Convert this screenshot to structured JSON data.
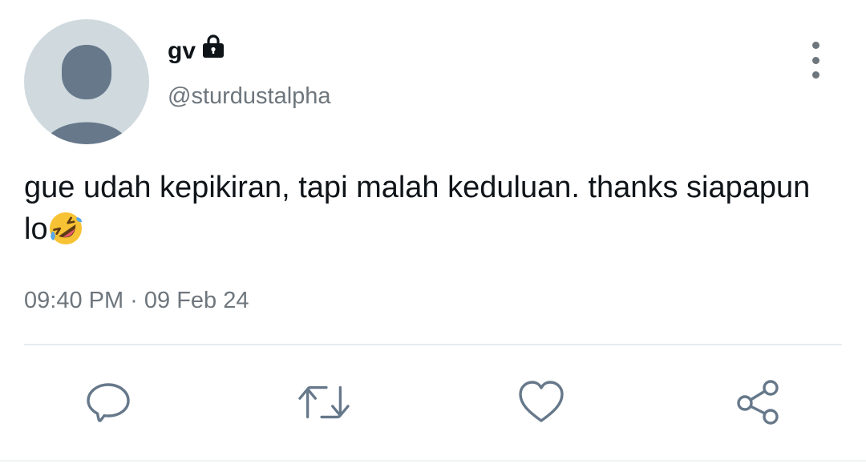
{
  "tweet": {
    "author": {
      "display_name": "gv",
      "handle": "@sturdustalpha",
      "protected_icon": "lock-icon",
      "avatar_icon": "default-avatar-icon"
    },
    "text": "gue udah kepikiran, tapi malah keduluan. thanks siapapun lo",
    "emoji": "rolling-on-floor-laughing-emoji",
    "timestamp": "09:40 PM · 09 Feb 24"
  },
  "menu": {
    "icon": "more-vertical-icon"
  },
  "actions": [
    {
      "name": "reply",
      "icon": "reply-icon"
    },
    {
      "name": "retweet",
      "icon": "retweet-icon"
    },
    {
      "name": "like",
      "icon": "heart-icon"
    },
    {
      "name": "share",
      "icon": "share-icon"
    }
  ],
  "colors": {
    "text_primary": "#0f1419",
    "text_secondary": "#6e767d",
    "avatar_bg": "#cfd9de",
    "avatar_fg": "#66788a",
    "divider": "#e6ecf0"
  }
}
